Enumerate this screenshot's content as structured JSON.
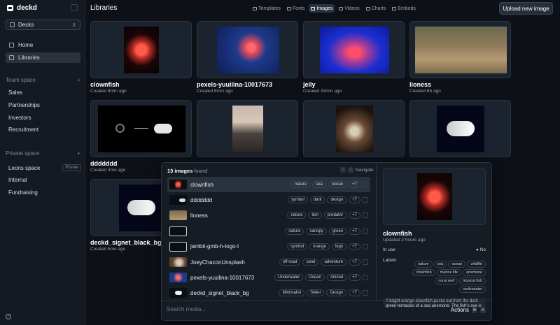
{
  "app": {
    "name": "deckd"
  },
  "sidebar": {
    "deck_select": "Decks",
    "nav": [
      {
        "label": "Home"
      },
      {
        "label": "Libraries"
      }
    ],
    "team_space": {
      "label": "Team space",
      "items": [
        "Sales",
        "Partnerships",
        "Investors",
        "Recruitment"
      ]
    },
    "private_space": {
      "label": "Private space",
      "items": [
        {
          "label": "Leons space",
          "badge": "Private"
        },
        {
          "label": "Internal"
        },
        {
          "label": "Fundraising"
        }
      ]
    }
  },
  "header": {
    "title": "Libraries",
    "tabs": [
      "Templates",
      "Fonts",
      "Images",
      "Videos",
      "Charts",
      "Embeds"
    ],
    "active_tab": "Images",
    "upload_label": "Upload new image"
  },
  "grid": [
    {
      "title": "clownfish",
      "sub": "Created 8min ago",
      "kind": "clownfish"
    },
    {
      "title": "pexels-yuuilina-10017673",
      "sub": "Created 8min ago",
      "kind": "starfish"
    },
    {
      "title": "jelly",
      "sub": "Created 33min ago",
      "kind": "jelly"
    },
    {
      "title": "lioness",
      "sub": "Created 6h ago",
      "kind": "lioness"
    },
    {
      "title": "ddddddd",
      "sub": "Created 3mo ago",
      "kind": "symbol"
    },
    {
      "title": "",
      "sub": "",
      "kind": "rocks"
    },
    {
      "title": "",
      "sub": "",
      "kind": "car"
    },
    {
      "title": "",
      "sub": "",
      "kind": "toggle"
    },
    {
      "title": "deckd_signet_black_bg",
      "sub": "Created 5mo ago",
      "kind": "signet"
    }
  ],
  "palette": {
    "count": "13 images",
    "count_suffix": "found",
    "navigate_label": "Navigate",
    "rows": [
      {
        "name": "clownfish",
        "tags": [
          "nature",
          "sea",
          "ocean"
        ],
        "more": "+7",
        "thumb": "clownfish"
      },
      {
        "name": "ddddddd",
        "tags": [
          "symbol",
          "dark",
          "design"
        ],
        "more": "+7",
        "thumb": "symbol"
      },
      {
        "name": "lioness",
        "tags": [
          "nature",
          "lion",
          "predator"
        ],
        "more": "+7",
        "thumb": "lioness"
      },
      {
        "name": "",
        "tags": [
          "nature",
          "canopy",
          "green"
        ],
        "more": "+7",
        "thumb": "broken"
      },
      {
        "name": "jambit-gmb-h-logo-l",
        "tags": [
          "symbol",
          "orange",
          "logo"
        ],
        "more": "+7",
        "thumb": "broken"
      },
      {
        "name": "JoeyChaconUnsplash",
        "tags": [
          "off-road",
          "sand",
          "adventure"
        ],
        "more": "+7",
        "thumb": "car"
      },
      {
        "name": "pexels-yuuilina-10017673",
        "tags": [
          "Underwater",
          "Ocean",
          "Animal"
        ],
        "more": "+7",
        "thumb": "starfish"
      },
      {
        "name": "deckd_signet_black_bg",
        "tags": [
          "Minimalist",
          "Slider",
          "Design"
        ],
        "more": "+7",
        "thumb": "signet"
      }
    ],
    "search_placeholder": "Search media...",
    "actions_label": "Actions",
    "shortcut_cmd": "⌘",
    "shortcut_key": "K"
  },
  "detail": {
    "title": "clownfish",
    "sub": "Updated 2 hours ago",
    "in_use_label": "In use",
    "in_use_value": "No",
    "labels_label": "Labels",
    "labels": [
      "nature",
      "sea",
      "ocean",
      "wildlife",
      "clownfish",
      "marine life",
      "anemone",
      "coral reef",
      "tropical fish",
      "underwater"
    ],
    "description": "A bright orange clownfish peeks out from the dark green tentacles of a sea anemone. The fish's eye is"
  }
}
